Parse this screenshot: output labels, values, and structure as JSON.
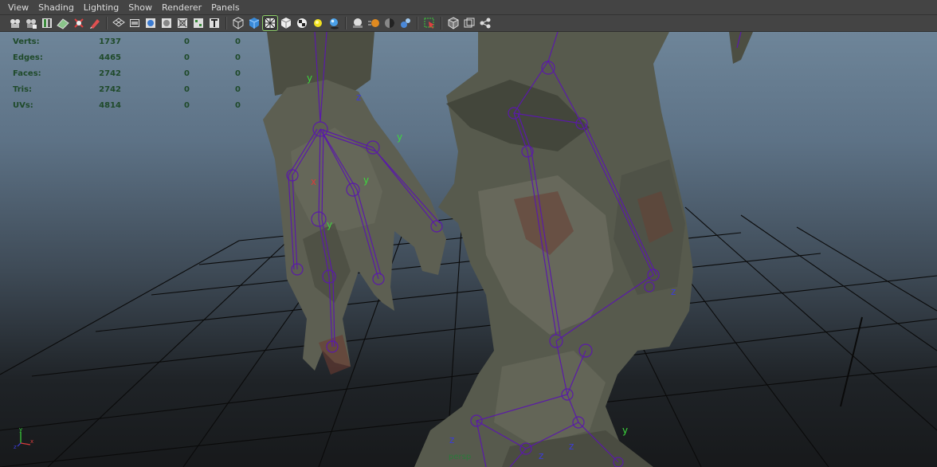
{
  "menu": {
    "items": [
      "View",
      "Shading",
      "Lighting",
      "Show",
      "Renderer",
      "Panels"
    ]
  },
  "toolbar": {
    "buttons": [
      "camera-select-icon",
      "camera-attributes-icon",
      "bookmark-icon",
      "image-plane-icon",
      "2d-pan-zoom-icon",
      "grease-pencil-icon",
      "grid-icon",
      "film-gate-icon",
      "resolution-gate-icon",
      "gate-mask-icon",
      "field-chart-icon",
      "safe-action-icon",
      "safe-title-icon",
      "wireframe-icon",
      "smooth-shade-icon",
      "wireframe-on-shaded-icon",
      "default-material-icon",
      "textured-icon",
      "use-all-lights-icon",
      "shadows-icon",
      "screen-space-ao-icon",
      "motion-blur-icon",
      "multisample-aa-icon",
      "depth-of-field-icon",
      "isolate-select-icon",
      "xray-icon",
      "xray-active-components-icon",
      "xray-joints-icon"
    ],
    "colors": {
      "bg": "#444444",
      "active_outline": "#8fd06a"
    }
  },
  "hud": {
    "rows": [
      {
        "label": "Verts:",
        "a": "1737",
        "b": "0",
        "c": "0"
      },
      {
        "label": "Edges:",
        "a": "4465",
        "b": "0",
        "c": "0"
      },
      {
        "label": "Faces:",
        "a": "2742",
        "b": "0",
        "c": "0"
      },
      {
        "label": "Tris:",
        "a": "2742",
        "b": "0",
        "c": "0"
      },
      {
        "label": "UVs:",
        "a": "4814",
        "b": "0",
        "c": "0"
      }
    ]
  },
  "viewport": {
    "camera": "persp",
    "axis_labels": {
      "x": "x",
      "y": "y",
      "z": "z"
    },
    "joint_axis_labels": [
      "y",
      "y",
      "y",
      "y",
      "y",
      "z",
      "z",
      "z",
      "z",
      "z",
      "x"
    ],
    "colors": {
      "skeleton": "#5a1aa8",
      "grid": "#0a0a0a",
      "skin": "#5a5c4c",
      "axis_y": "#3cd83c",
      "axis_x": "#d83c3c",
      "axis_z": "#3c3cd8"
    }
  }
}
